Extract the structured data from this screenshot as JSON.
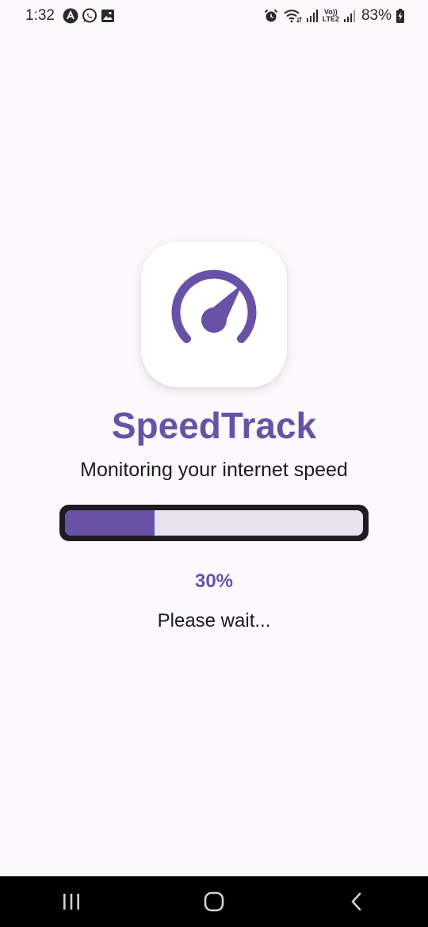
{
  "status_bar": {
    "time": "1:32",
    "battery": "83%",
    "left_icons": [
      "app-notification-icon",
      "whatsapp-icon",
      "gallery-icon"
    ],
    "right_icons": [
      "alarm-icon",
      "wifi-icon",
      "signal-icon",
      "volte-lte2-icon",
      "signal-2-icon",
      "battery-charging-icon"
    ],
    "network_label_top": "Vo))",
    "network_label_bottom": "LTE2"
  },
  "app": {
    "title": "SpeedTrack",
    "subtitle": "Monitoring your internet speed",
    "progress": 0.3,
    "progress_label": "30%",
    "status_text": "Please wait...",
    "icon": "speedometer-icon"
  },
  "colors": {
    "accent": "#6851a6",
    "track": "#e8e1ee",
    "track_border": "#1e1c22",
    "background": "#fdf8fc"
  },
  "nav_bar": {
    "buttons": [
      "recents-icon",
      "home-icon",
      "back-icon"
    ]
  }
}
